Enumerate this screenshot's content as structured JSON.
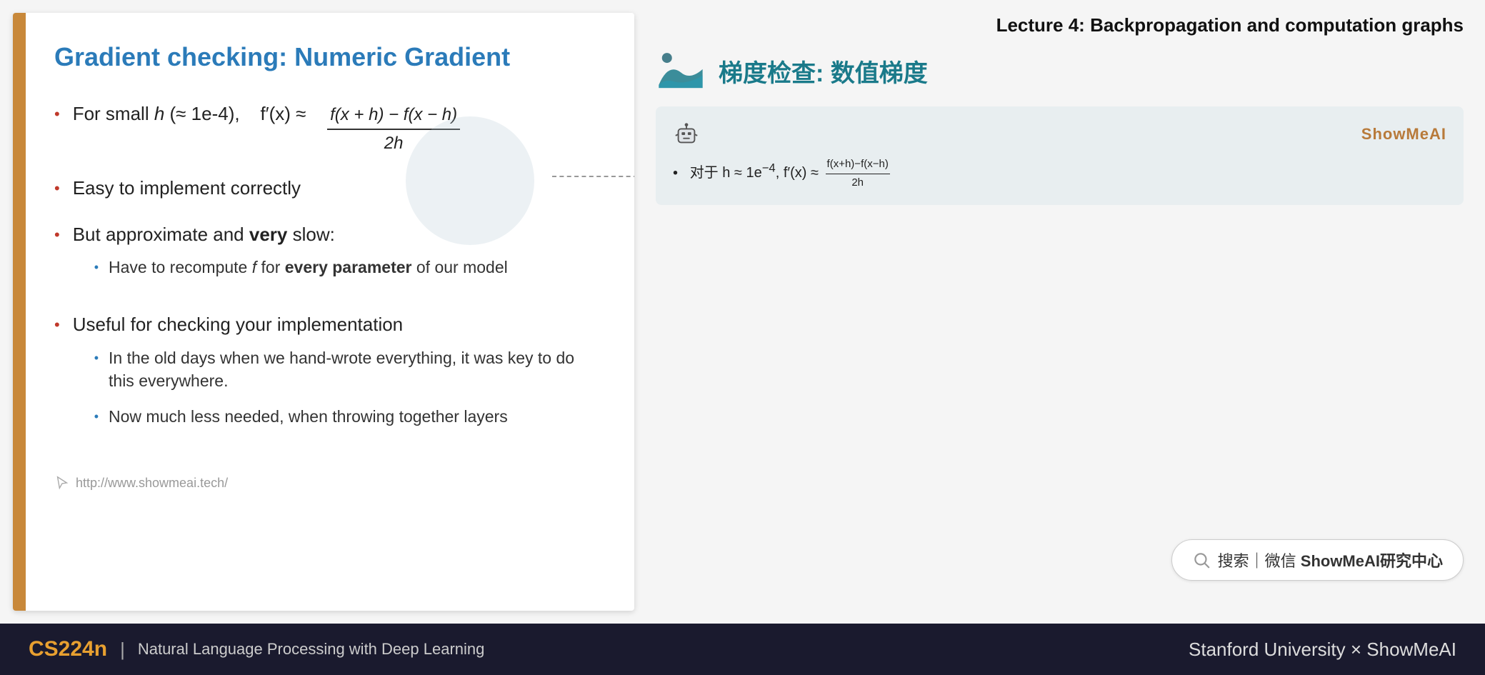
{
  "lecture": {
    "title": "Lecture 4:  Backpropagation and computation graphs"
  },
  "slide": {
    "title": "Gradient checking: Numeric Gradient",
    "left_bar_color": "#c8883a",
    "bullets": [
      {
        "type": "main",
        "text_before": "For small ",
        "h_italic": "h",
        "text_middle": " (≈ 1e-4),   f′(x) ≈ ",
        "formula": true,
        "numerator": "f(x + h) − f(x − h)",
        "denominator": "2h"
      },
      {
        "type": "main",
        "text": "Easy to implement correctly"
      },
      {
        "type": "main",
        "text_before": "But approximate and ",
        "bold_text": "very",
        "text_after": " slow:",
        "sub_bullets": [
          {
            "text_before": "Have to recompute ",
            "italic": "f",
            "text_middle": " for ",
            "bold": "every parameter",
            "text_after": " of our model"
          }
        ]
      },
      {
        "type": "main",
        "text": "Useful for checking your implementation",
        "sub_bullets": [
          {
            "text": "In the old days when we hand-wrote everything, it was key to do this everywhere."
          },
          {
            "text": "Now much less needed, when throwing together layers"
          }
        ]
      }
    ],
    "url": "http://www.showmeai.tech/"
  },
  "right_panel": {
    "dots": [
      {
        "color": "#555",
        "size": "sm"
      },
      {
        "color": "#1a7a8a",
        "size": "md"
      },
      {
        "color": "#1a9ab0",
        "size": "lg"
      }
    ],
    "chinese_title": "梯度检查: 数值梯度",
    "translation_box": {
      "brand": "ShowMeAI",
      "content": "对于 h ≈ 1e⁻⁴, f′(x) ≈",
      "formula_numerator": "f(x+h)−f(x−h)",
      "formula_denominator": "2h"
    },
    "search_bar": {
      "placeholder": "搜索｜微信 ShowMeAI研究中心"
    }
  },
  "bottom_bar": {
    "course_code": "CS224n",
    "divider": "|",
    "subtitle": "Natural Language Processing with Deep Learning",
    "right_text": "Stanford University × ShowMeAI"
  }
}
